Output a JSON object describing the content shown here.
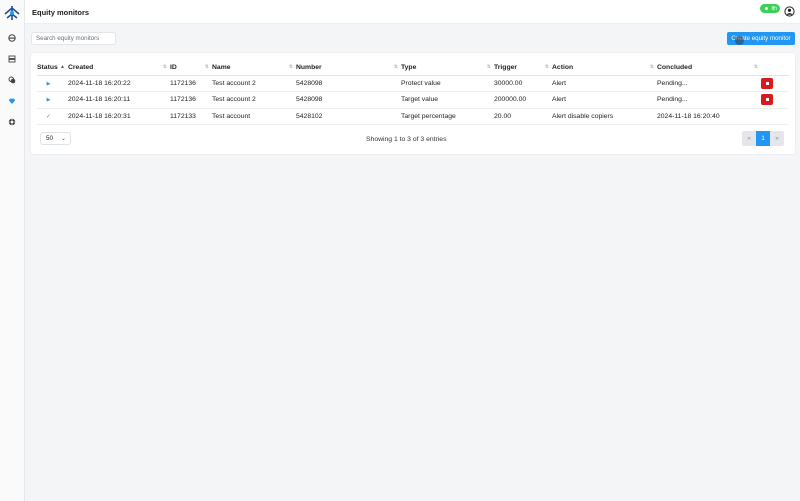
{
  "topbar": {
    "title": "Equity monitors",
    "badge": "8h"
  },
  "search": {
    "placeholder": "Search equity monitors"
  },
  "toolbar": {
    "create_label": "Create equity monitor"
  },
  "table": {
    "columns": [
      "Status",
      "Created",
      "ID",
      "Name",
      "Number",
      "Type",
      "Trigger",
      "Action",
      "Concluded"
    ],
    "rows": [
      {
        "status": "▶",
        "created": "2024-11-18 16:20:22",
        "id": "1172136",
        "name": "Test account 2",
        "number": "5428098",
        "type": "Protect value",
        "trigger": "30000.00",
        "action": "Alert",
        "concluded": "Pending..."
      },
      {
        "status": "▶",
        "created": "2024-11-18 16:20:11",
        "id": "1172136",
        "name": "Test account 2",
        "number": "5428098",
        "type": "Target value",
        "trigger": "200000.00",
        "action": "Alert",
        "concluded": "Pending..."
      },
      {
        "status": "✓",
        "created": "2024-11-18 16:20:31",
        "id": "1172133",
        "name": "Test account",
        "number": "5428102",
        "type": "Target percentage",
        "trigger": "20.00",
        "action": "Alert disable copiers",
        "concluded": "2024-11-18 16:20:40"
      }
    ]
  },
  "footer": {
    "page_length": "50",
    "info": "Showing 1 to 3 of 3 entries",
    "prev": "«",
    "current_page": "1",
    "next": "»"
  },
  "icons": {
    "stop": "stop-icon",
    "play": "play-icon",
    "check": "check-icon"
  },
  "colors": {
    "accent": "#2196f3",
    "danger": "#d9191c",
    "success": "#3ecf5a"
  }
}
